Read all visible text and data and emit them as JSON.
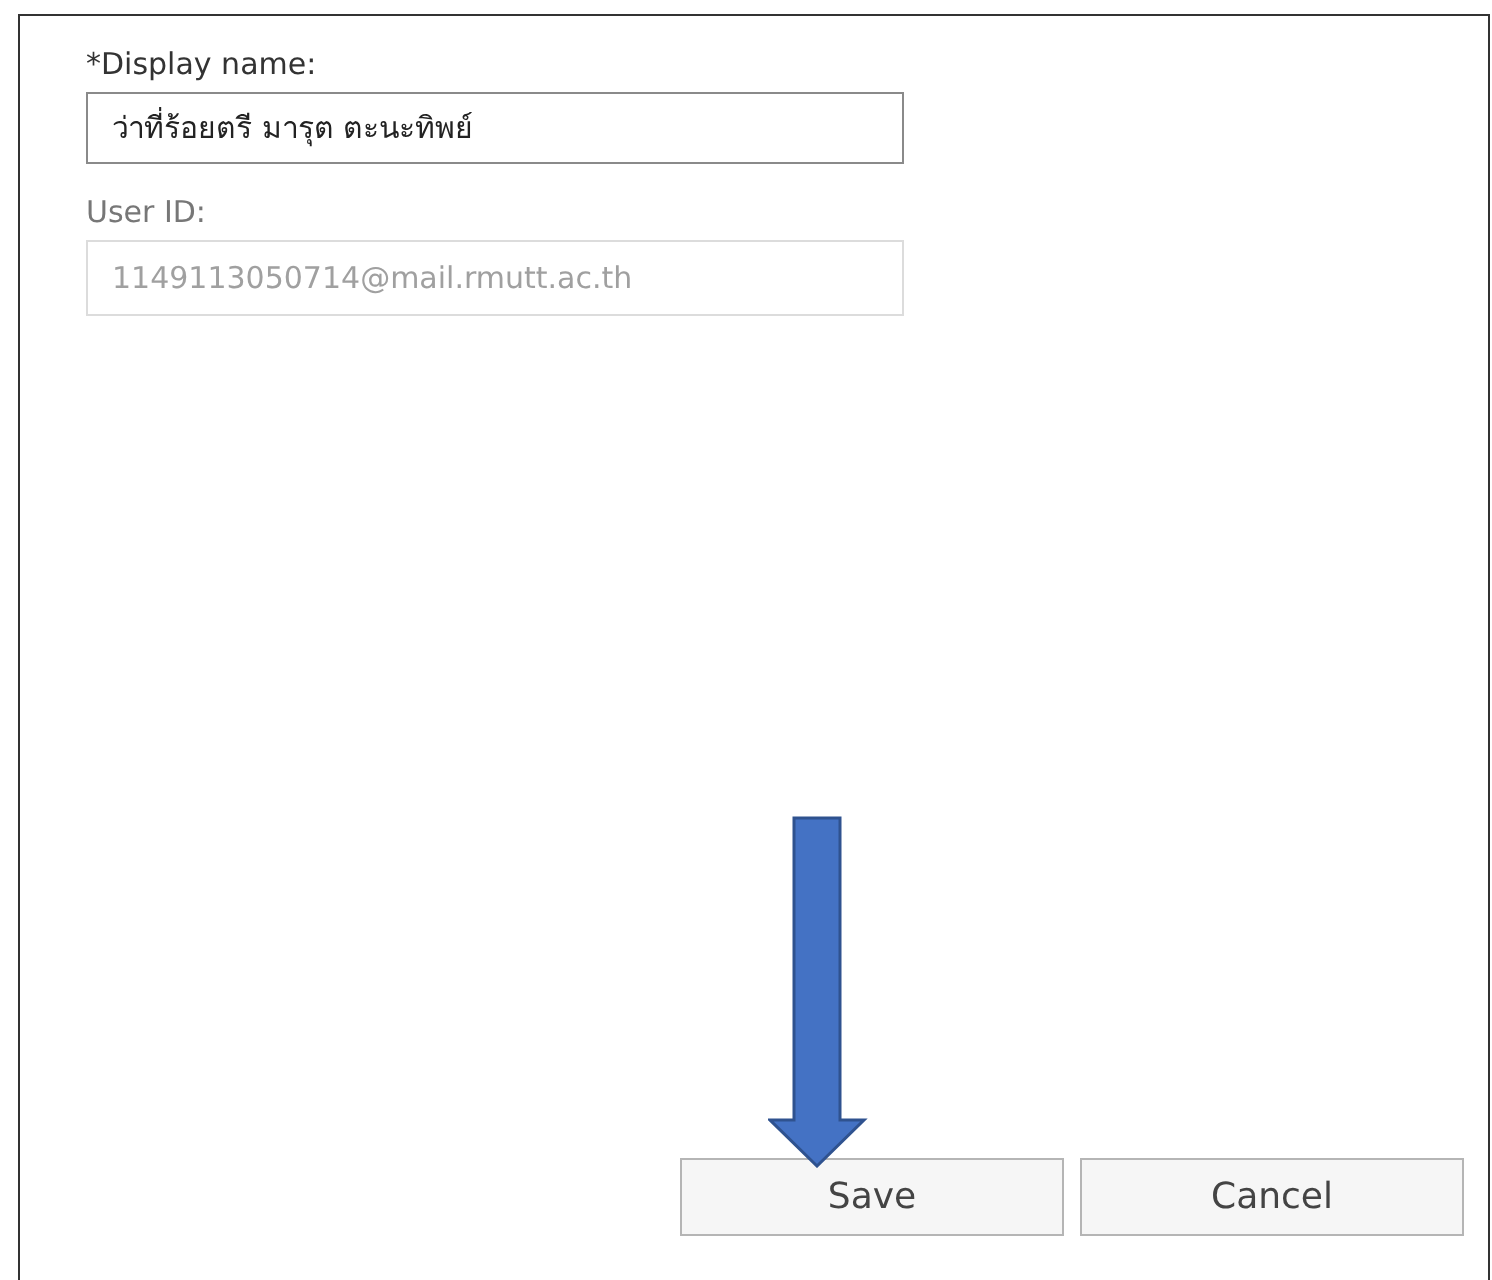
{
  "fields": [
    {
      "label": "*Display name:",
      "value": "ว่าที่ร้อยตรี มารุต ตะนะทิพย์",
      "disabled": false
    },
    {
      "label": "User ID:",
      "value": "1149113050714@mail.rmutt.ac.th",
      "disabled": true
    }
  ],
  "buttons": [
    {
      "label": "Save"
    },
    {
      "label": "Cancel"
    }
  ]
}
